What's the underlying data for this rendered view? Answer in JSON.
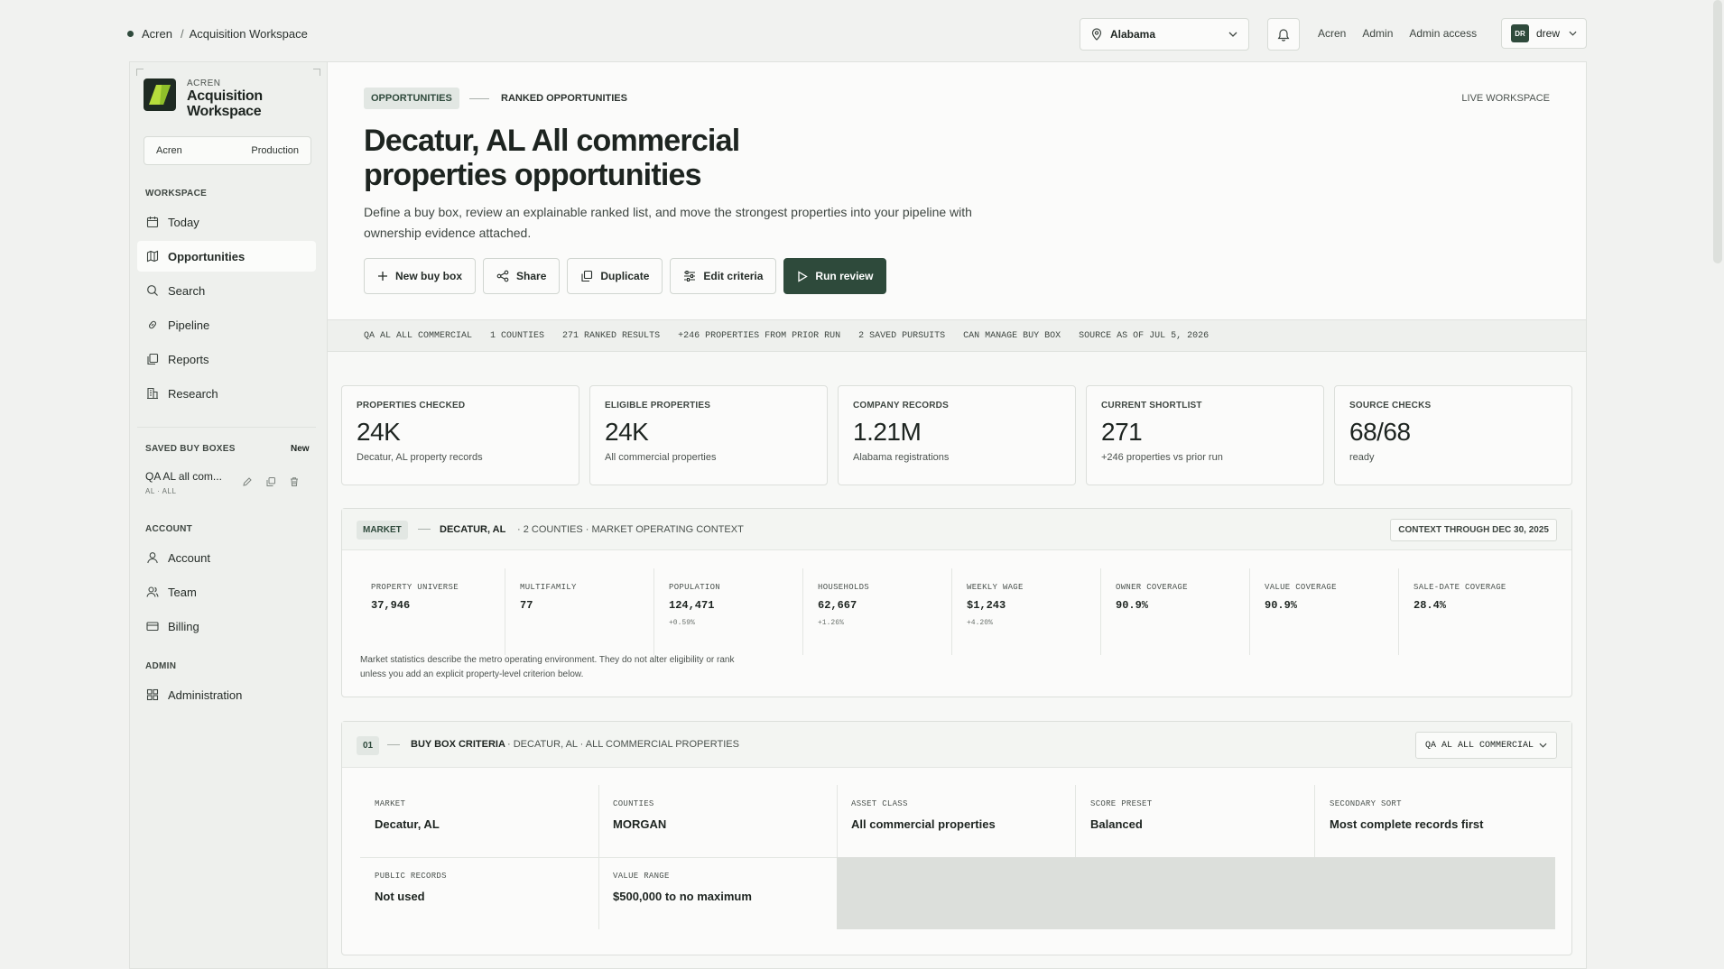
{
  "topbar": {
    "breadcrumb_root": "Acren",
    "breadcrumb_current": "Acquisition Workspace",
    "region": "Alabama",
    "links": [
      "Acren",
      "Admin",
      "Admin access"
    ],
    "user_initials": "DR",
    "user_name": "drew"
  },
  "sidebar": {
    "brand_small": "ACREN",
    "brand_title_1": "Acquisition",
    "brand_title_2": "Workspace",
    "env_org": "Acren",
    "env_mode": "Production",
    "workspace_label": "WORKSPACE",
    "workspace_items": [
      {
        "label": "Today",
        "icon": "calendar-icon"
      },
      {
        "label": "Opportunities",
        "icon": "map-icon"
      },
      {
        "label": "Search",
        "icon": "search-icon"
      },
      {
        "label": "Pipeline",
        "icon": "link-icon"
      },
      {
        "label": "Reports",
        "icon": "copy-icon"
      },
      {
        "label": "Research",
        "icon": "building-icon"
      }
    ],
    "saved_label": "SAVED BUY BOXES",
    "saved_new": "New",
    "saved_item": "QA AL all com...",
    "saved_item_sub": "AL  ·  ALL",
    "account_label": "ACCOUNT",
    "account_items": [
      {
        "label": "Account",
        "icon": "user-icon"
      },
      {
        "label": "Team",
        "icon": "users-icon"
      },
      {
        "label": "Billing",
        "icon": "card-icon"
      }
    ],
    "admin_label": "ADMIN",
    "admin_items": [
      {
        "label": "Administration",
        "icon": "grid-icon"
      }
    ]
  },
  "header": {
    "pill": "OPPORTUNITIES",
    "pill_next": "RANKED OPPORTUNITIES",
    "live": "LIVE WORKSPACE",
    "title": "Decatur, AL All commercial properties opportunities",
    "description": "Define a buy box, review an explainable ranked list, and move the strongest properties into your pipeline with ownership evidence attached.",
    "buttons": {
      "new_buy_box": "New buy box",
      "share": "Share",
      "duplicate": "Duplicate",
      "edit_criteria": "Edit criteria",
      "run_review": "Run review"
    }
  },
  "statusbar": [
    "QA AL ALL COMMERCIAL",
    "1 COUNTIES",
    "271 RANKED RESULTS",
    "+246 PROPERTIES FROM PRIOR RUN",
    "2 SAVED PURSUITS",
    "CAN MANAGE BUY BOX",
    "SOURCE AS OF JUL 5, 2026"
  ],
  "cards": [
    {
      "label": "PROPERTIES CHECKED",
      "value": "24K",
      "sub": "Decatur, AL property records"
    },
    {
      "label": "ELIGIBLE PROPERTIES",
      "value": "24K",
      "sub": "All commercial properties"
    },
    {
      "label": "COMPANY RECORDS",
      "value": "1.21M",
      "sub": "Alabama registrations"
    },
    {
      "label": "CURRENT SHORTLIST",
      "value": "271",
      "sub": "+246 properties vs prior run"
    },
    {
      "label": "SOURCE CHECKS",
      "value": "68/68",
      "sub": "ready"
    }
  ],
  "market": {
    "tag": "MARKET",
    "location": "DECATUR, AL",
    "context": "· 2 COUNTIES · MARKET OPERATING CONTEXT",
    "through": "CONTEXT THROUGH DEC 30, 2025",
    "stats": [
      {
        "label": "PROPERTY UNIVERSE",
        "value": "37,946",
        "delta": ""
      },
      {
        "label": "MULTIFAMILY",
        "value": "77",
        "delta": ""
      },
      {
        "label": "POPULATION",
        "value": "124,471",
        "delta": "+0.59%"
      },
      {
        "label": "HOUSEHOLDS",
        "value": "62,667",
        "delta": "+1.26%"
      },
      {
        "label": "WEEKLY WAGE",
        "value": "$1,243",
        "delta": "+4.20%"
      },
      {
        "label": "OWNER COVERAGE",
        "value": "90.9%",
        "delta": ""
      },
      {
        "label": "VALUE COVERAGE",
        "value": "90.9%",
        "delta": ""
      },
      {
        "label": "SALE-DATE COVERAGE",
        "value": "28.4%",
        "delta": ""
      }
    ],
    "note": "Market statistics describe the metro operating environment. They do not alter eligibility or rank unless you add an explicit property-level criterion below."
  },
  "criteria": {
    "index": "01",
    "title": "BUY BOX CRITERIA",
    "context": "· DECATUR, AL · ALL COMMERCIAL PROPERTIES",
    "selector": "QA AL ALL COMMERCIAL",
    "cells": [
      {
        "label": "MARKET",
        "value": "Decatur, AL"
      },
      {
        "label": "COUNTIES",
        "value": "MORGAN"
      },
      {
        "label": "ASSET CLASS",
        "value": "All commercial properties"
      },
      {
        "label": "SCORE PRESET",
        "value": "Balanced"
      },
      {
        "label": "SECONDARY SORT",
        "value": "Most complete records first"
      },
      {
        "label": "PUBLIC RECORDS",
        "value": "Not used"
      },
      {
        "label": "VALUE RANGE",
        "value": "$500,000 to no maximum"
      }
    ]
  },
  "colors": {
    "accent": "#2e4a3b",
    "background": "#f1f2f0",
    "panel": "#fbfbfa"
  }
}
